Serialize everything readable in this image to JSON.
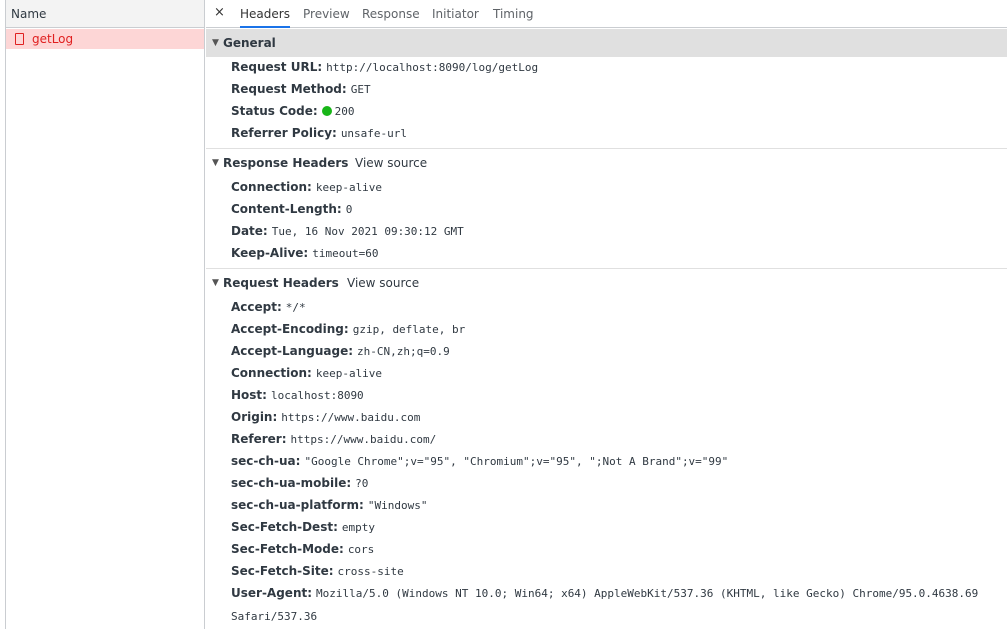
{
  "request_list": {
    "header": "Name",
    "items": [
      {
        "name": "getLog"
      }
    ]
  },
  "tabs": {
    "close": "×",
    "items": [
      "Headers",
      "Preview",
      "Response",
      "Initiator",
      "Timing"
    ],
    "active": "Headers"
  },
  "general": {
    "title": "General",
    "rows": [
      {
        "key": "Request URL:",
        "value": "http://localhost:8090/log/getLog"
      },
      {
        "key": "Request Method:",
        "value": "GET"
      },
      {
        "key": "Status Code:",
        "value": "200"
      },
      {
        "key": "Referrer Policy:",
        "value": "unsafe-url"
      }
    ]
  },
  "response_headers": {
    "title": "Response Headers",
    "view_source": "View source",
    "rows": [
      {
        "key": "Connection:",
        "value": "keep-alive"
      },
      {
        "key": "Content-Length:",
        "value": "0"
      },
      {
        "key": "Date:",
        "value": "Tue, 16 Nov 2021 09:30:12 GMT"
      },
      {
        "key": "Keep-Alive:",
        "value": "timeout=60"
      }
    ]
  },
  "request_headers": {
    "title": "Request Headers",
    "view_source": "View source",
    "rows": [
      {
        "key": "Accept:",
        "value": "*/*"
      },
      {
        "key": "Accept-Encoding:",
        "value": "gzip, deflate, br"
      },
      {
        "key": "Accept-Language:",
        "value": "zh-CN,zh;q=0.9"
      },
      {
        "key": "Connection:",
        "value": "keep-alive"
      },
      {
        "key": "Host:",
        "value": "localhost:8090"
      },
      {
        "key": "Origin:",
        "value": "https://www.baidu.com"
      },
      {
        "key": "Referer:",
        "value": "https://www.baidu.com/"
      },
      {
        "key": "sec-ch-ua:",
        "value": "\"Google Chrome\";v=\"95\", \"Chromium\";v=\"95\", \";Not A Brand\";v=\"99\""
      },
      {
        "key": "sec-ch-ua-mobile:",
        "value": "?0"
      },
      {
        "key": "sec-ch-ua-platform:",
        "value": "\"Windows\""
      },
      {
        "key": "Sec-Fetch-Dest:",
        "value": "empty"
      },
      {
        "key": "Sec-Fetch-Mode:",
        "value": "cors"
      },
      {
        "key": "Sec-Fetch-Site:",
        "value": "cross-site"
      },
      {
        "key": "User-Agent:",
        "value": "Mozilla/5.0 (Windows NT 10.0; Win64; x64) AppleWebKit/537.36 (KHTML, like Gecko) Chrome/95.0.4638.69 Safari/537.36"
      }
    ]
  },
  "colors": {
    "status_ok": "#18b618",
    "error_row_bg": "#fdd6d6",
    "error_text": "#e02020",
    "active_tab": "#1a73e8"
  }
}
